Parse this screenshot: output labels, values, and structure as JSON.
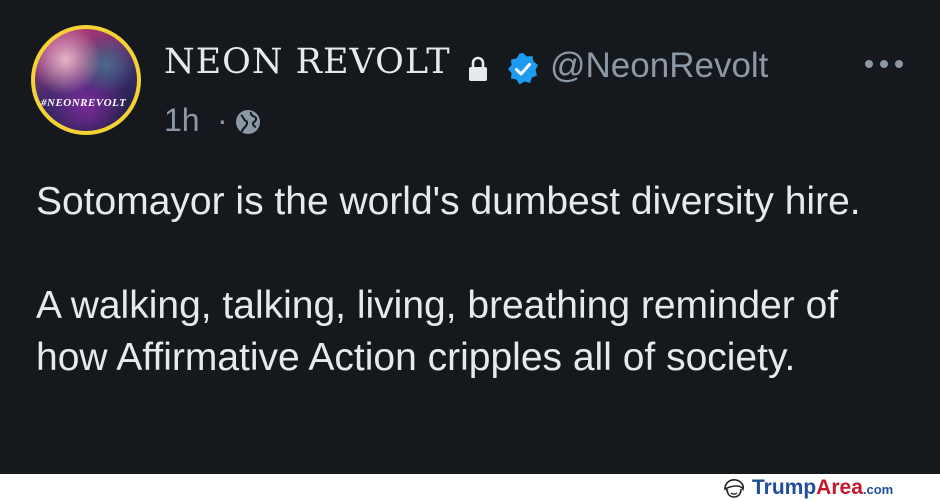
{
  "post": {
    "display_name": "NEON REVOLT",
    "handle": "@NeonRevolt",
    "timestamp": "1h",
    "separator": "·",
    "visibility_icon": "globe-icon",
    "lock_icon": "lock-icon",
    "verified_icon": "verified-badge-icon",
    "more_icon": "more-options-icon",
    "avatar_label": "#NEONREVOLT",
    "body": [
      "Sotomayor is the world's dumbest diversity hire.",
      "A walking, talking, living, breathing reminder of how Affirmative Action cripples all of society."
    ]
  },
  "colors": {
    "background": "#15181c",
    "text": "#e7e9ea",
    "muted": "#8b98a5",
    "verified": "#1d9bf0",
    "avatar_ring": "#f3d334"
  },
  "watermark": {
    "part1": "Trump",
    "part2": "Area",
    "part3": ".com",
    "icon": "toupee-logo-icon"
  }
}
